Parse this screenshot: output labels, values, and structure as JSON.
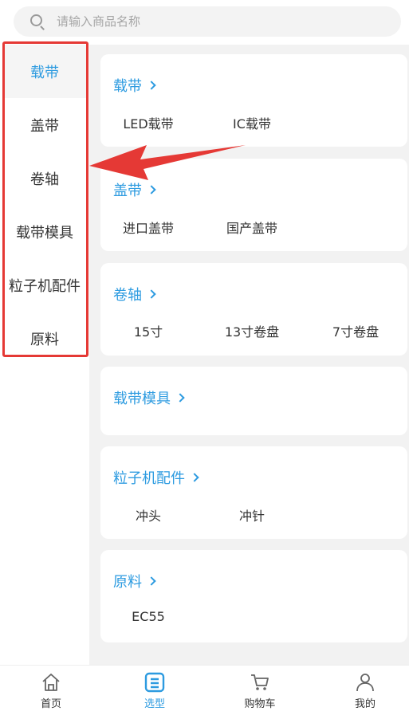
{
  "search": {
    "placeholder": "请输入商品名称"
  },
  "sidebar": {
    "items": [
      {
        "label": "载带",
        "active": true
      },
      {
        "label": "盖带"
      },
      {
        "label": "卷轴"
      },
      {
        "label": "载带模具"
      },
      {
        "label": "粒子机配件"
      },
      {
        "label": "原料"
      }
    ]
  },
  "categories": [
    {
      "title": "载带",
      "items": [
        "LED载带",
        "IC载带"
      ]
    },
    {
      "title": "盖带",
      "items": [
        "进口盖带",
        "国产盖带"
      ]
    },
    {
      "title": "卷轴",
      "items": [
        "15寸",
        "13寸卷盘",
        "7寸卷盘"
      ]
    },
    {
      "title": "载带模具",
      "items": []
    },
    {
      "title": "粒子机配件",
      "items": [
        "冲头",
        "冲针"
      ]
    },
    {
      "title": "原料",
      "items": [
        "EC55"
      ]
    }
  ],
  "tabbar": {
    "tabs": [
      {
        "label": "首页",
        "icon": "home-icon"
      },
      {
        "label": "选型",
        "icon": "select-icon",
        "active": true
      },
      {
        "label": "购物车",
        "icon": "cart-icon"
      },
      {
        "label": "我的",
        "icon": "user-icon"
      }
    ]
  },
  "colors": {
    "accent": "#2d9be0",
    "highlight": "#e53935",
    "background": "#f2f2f2"
  }
}
